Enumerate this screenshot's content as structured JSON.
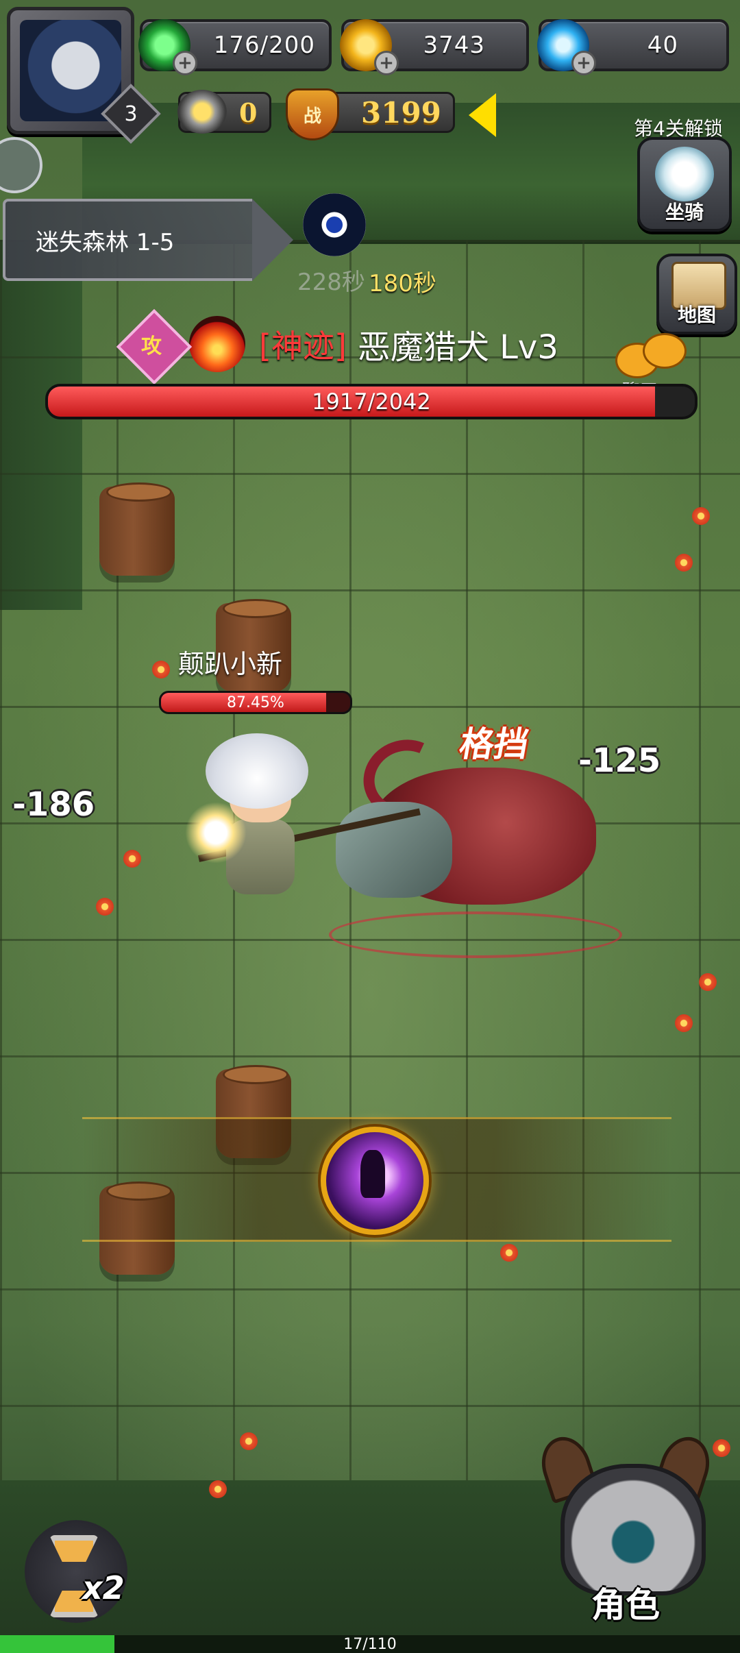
{
  "hud": {
    "level": "3",
    "stamina": "176/200",
    "gold": "3743",
    "diamond": "40",
    "vip": "0",
    "power_label": "战",
    "power": "3199"
  },
  "stage": {
    "name": "迷失森林 1-5"
  },
  "side_buttons": {
    "unlock_tip": "第4关解锁",
    "mount": "坐骑",
    "map": "地图",
    "chat": "聊天"
  },
  "timer": {
    "old": "228秒",
    "new": "180秒"
  },
  "boss": {
    "attack_badge": "攻",
    "rarity": "[神迹]",
    "name": "恶魔猎犬 Lv3",
    "hp_text": "1917/2042",
    "hp_fraction": 0.9388
  },
  "player": {
    "name": "颠趴小新",
    "hp_text": "87.45%",
    "hp_fraction": 0.8745
  },
  "combat_text": {
    "damage_left": "-186",
    "damage_right": "-125",
    "block": "格挡"
  },
  "bottom": {
    "speed": "x2",
    "role_label": "角色",
    "exp_text": "17/110",
    "exp_fraction": 0.1545
  },
  "colors": {
    "hp_red": "#d8282a",
    "gold_text": "#ffd75e",
    "exp_green": "#35c43a",
    "rarity_red": "#ff3a3a",
    "timer_yellow": "#ffe066"
  },
  "icons": [
    "avatar",
    "stamina-icon",
    "gold-coin-icon",
    "diamond-icon",
    "vip-wings-icon",
    "power-shield-icon",
    "collapse-arrow-icon",
    "timer-eye-icon",
    "attack-badge-icon",
    "fire-element-icon",
    "mount-wolf-icon",
    "map-scroll-icon",
    "chat-bubbles-icon",
    "skill-icon",
    "hourglass-icon",
    "helmet-icon"
  ]
}
